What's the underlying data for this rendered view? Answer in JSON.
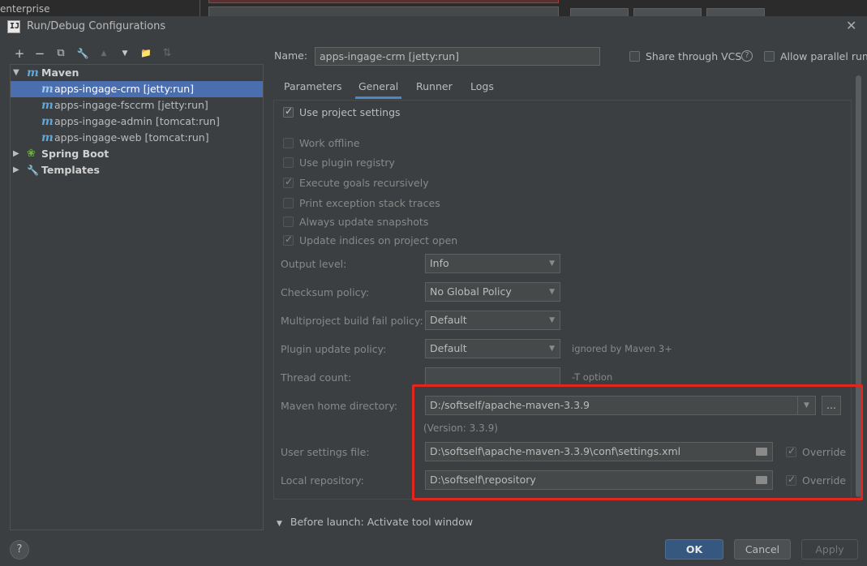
{
  "background": {
    "project_text": "enterprise"
  },
  "window": {
    "title": "Run/Debug Configurations"
  },
  "toolbar": {
    "add": "+",
    "remove": "−",
    "copy": "⧉",
    "edit": "🔧",
    "move_up": "▲",
    "move_down": "▼",
    "folder": "📁",
    "sort": "⇅"
  },
  "tree": {
    "maven_label": "Maven",
    "maven_items": [
      "apps-ingage-crm [jetty:run]",
      "apps-ingage-fsccrm [jetty:run]",
      "apps-ingage-admin [tomcat:run]",
      "apps-ingage-web [tomcat:run]"
    ],
    "spring_boot_label": "Spring Boot",
    "templates_label": "Templates"
  },
  "header": {
    "name_label": "Name:",
    "name_value": "apps-ingage-crm [jetty:run]",
    "share_vcs_label": "Share through VCS",
    "allow_parallel_label": "Allow parallel run"
  },
  "tabs": [
    "Parameters",
    "General",
    "Runner",
    "Logs"
  ],
  "active_tab": "General",
  "general": {
    "use_project_settings": "Use project settings",
    "options": [
      {
        "label": "Work offline",
        "checked": false
      },
      {
        "label": "Use plugin registry",
        "checked": false
      },
      {
        "label": "Execute goals recursively",
        "checked": true
      },
      {
        "label": "Print exception stack traces",
        "checked": false
      },
      {
        "label": "Always update snapshots",
        "checked": false
      },
      {
        "label": "Update indices on project open",
        "checked": true
      }
    ],
    "output_level_label": "Output level:",
    "output_level_value": "Info",
    "checksum_label": "Checksum policy:",
    "checksum_value": "No Global Policy",
    "multiproject_label": "Multiproject build fail policy:",
    "multiproject_value": "Default",
    "plugin_update_label": "Plugin update policy:",
    "plugin_update_value": "Default",
    "plugin_update_hint": "ignored by Maven 3+",
    "thread_count_label": "Thread count:",
    "thread_count_value": "",
    "thread_count_hint": "-T option",
    "maven_home_label": "Maven home directory:",
    "maven_home_value": "D:/softself/apache-maven-3.3.9",
    "browse_label": "...",
    "version_text": "(Version: 3.3.9)",
    "user_settings_label": "User settings file:",
    "user_settings_value": "D:\\softself\\apache-maven-3.3.9\\conf\\settings.xml",
    "local_repo_label": "Local repository:",
    "local_repo_value": "D:\\softself\\repository",
    "override_label": "Override"
  },
  "footer": {
    "before_launch": "Before launch: Activate tool window",
    "help": "?",
    "ok": "OK",
    "cancel": "Cancel",
    "apply": "Apply"
  },
  "colors": {
    "highlight": "#e3261e",
    "selection": "#4b6eaf",
    "ok_button": "#365880"
  }
}
